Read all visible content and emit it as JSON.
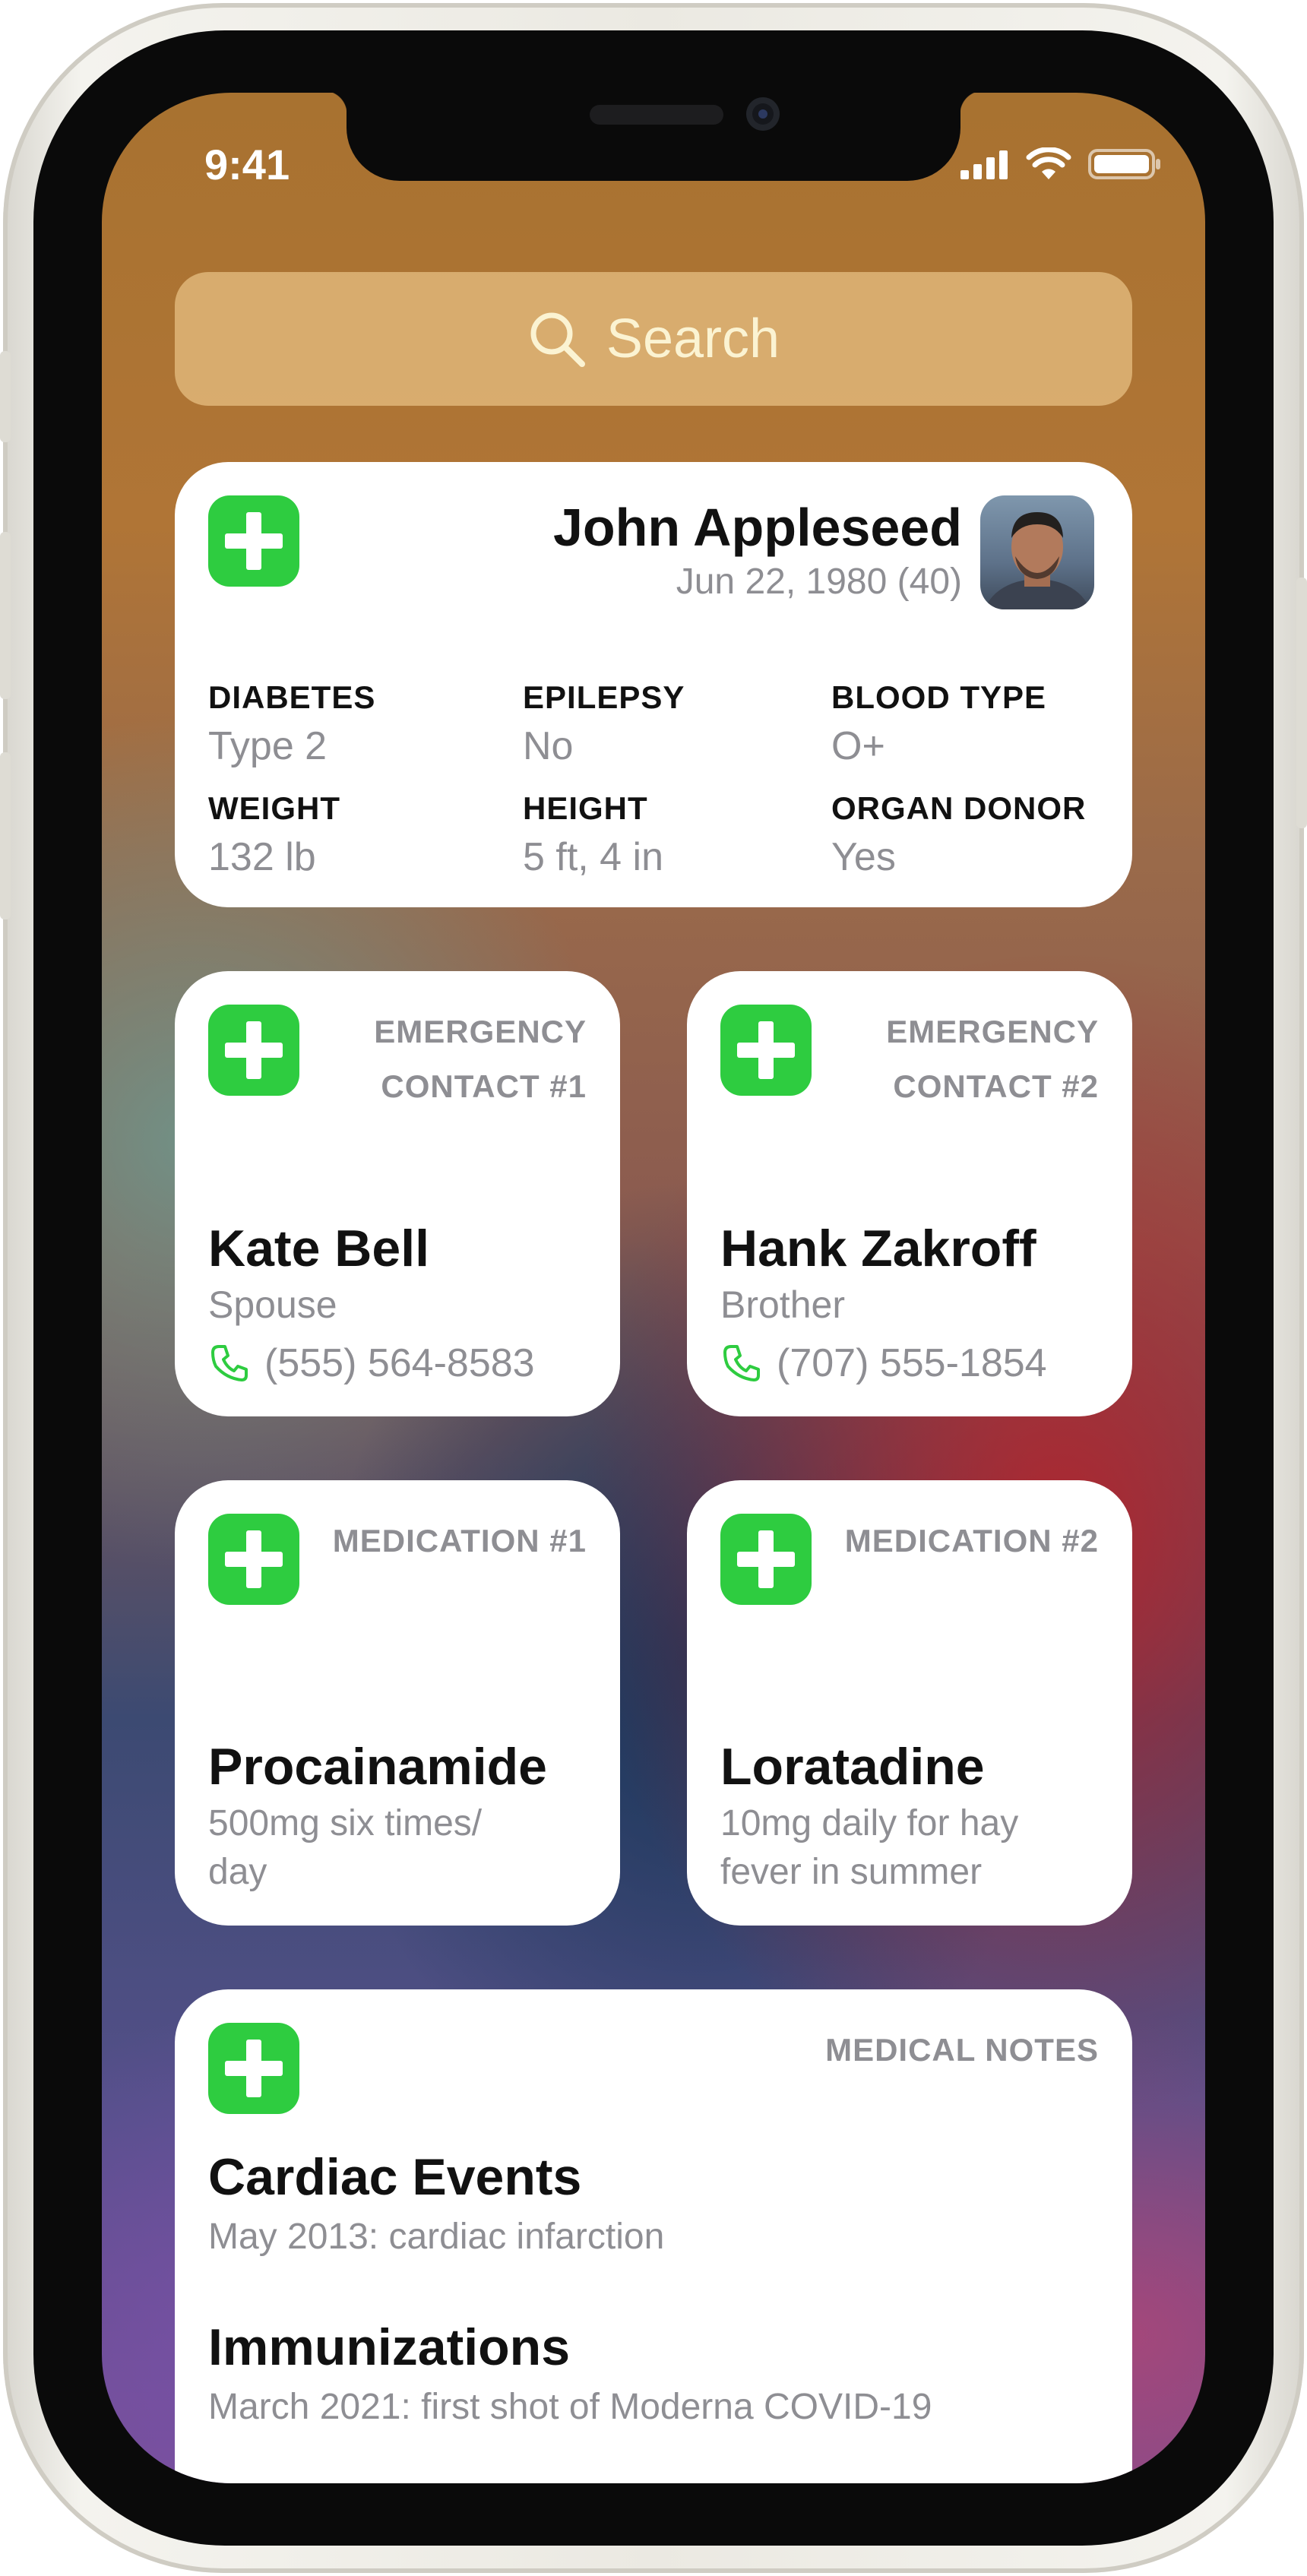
{
  "status_bar": {
    "time": "9:41"
  },
  "search": {
    "label": "Search"
  },
  "profile": {
    "name": "John Appleseed",
    "birth": "Jun 22, 1980 (40)",
    "fields": [
      {
        "label": "DIABETES",
        "value": "Type 2"
      },
      {
        "label": "EPILEPSY",
        "value": "No"
      },
      {
        "label": "BLOOD TYPE",
        "value": "O+"
      },
      {
        "label": "WEIGHT",
        "value": "132 lb"
      },
      {
        "label": "HEIGHT",
        "value": "5 ft, 4 in"
      },
      {
        "label": "ORGAN DONOR",
        "value": "Yes"
      }
    ]
  },
  "contacts": [
    {
      "kicker_line1": "EMERGENCY",
      "kicker_line2": "CONTACT #1",
      "name": "Kate Bell",
      "relation": "Spouse",
      "phone": "(555) 564-8583"
    },
    {
      "kicker_line1": "EMERGENCY",
      "kicker_line2": "CONTACT #2",
      "name": "Hank Zakroff",
      "relation": "Brother",
      "phone": "(707) 555-1854"
    }
  ],
  "medications": [
    {
      "kicker": "MEDICATION #1",
      "name": "Procainamide",
      "line1": "500mg six times/",
      "line2": "day"
    },
    {
      "kicker": "MEDICATION #2",
      "name": "Loratadine",
      "line1": "10mg daily for hay",
      "line2": "fever in summer"
    }
  ],
  "notes": {
    "kicker": "MEDICAL NOTES",
    "items": [
      {
        "title": "Cardiac Events",
        "detail": "May 2013: cardiac infarction"
      },
      {
        "title": "Immunizations",
        "detail": "March 2021: first shot of Moderna COVID-19"
      }
    ]
  },
  "colors": {
    "accent_green": "#2ecc40",
    "secondary_text": "#8e8e93"
  }
}
